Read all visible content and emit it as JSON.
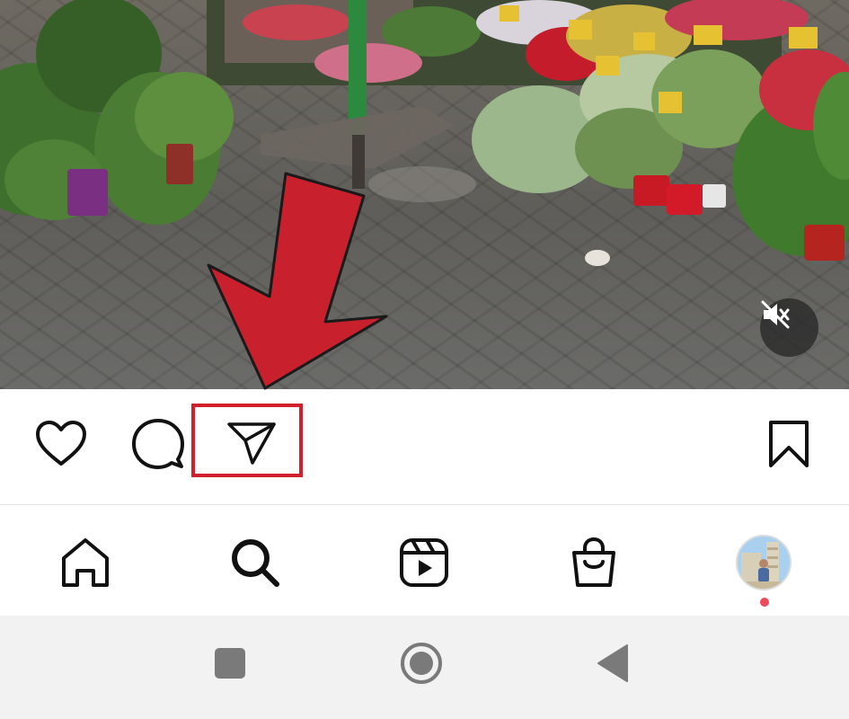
{
  "post": {
    "caption_preview": ""
  },
  "video": {
    "audio_state": "muted",
    "mute_icon": "speaker-muted-icon"
  },
  "actions": {
    "like_icon": "heart-outline-icon",
    "comment_icon": "speech-bubble-icon",
    "share_icon": "paper-plane-icon",
    "save_icon": "bookmark-outline-icon",
    "highlighted": "share"
  },
  "bottom_nav": {
    "items": [
      {
        "id": "home",
        "icon": "home-icon"
      },
      {
        "id": "search",
        "icon": "search-icon"
      },
      {
        "id": "reels",
        "icon": "reels-icon"
      },
      {
        "id": "shop",
        "icon": "shopping-bag-icon"
      },
      {
        "id": "profile",
        "icon": "profile-avatar",
        "has_notification": true
      }
    ]
  },
  "system_bar": {
    "buttons": [
      "recents-square-icon",
      "home-circle-icon",
      "back-triangle-icon"
    ]
  },
  "colors": {
    "highlight_box": "#d1202b",
    "arrow_fill": "#c8202c",
    "notification_dot": "#ed4956",
    "icon_color": "#111111",
    "system_button": "#7a7a7a"
  }
}
